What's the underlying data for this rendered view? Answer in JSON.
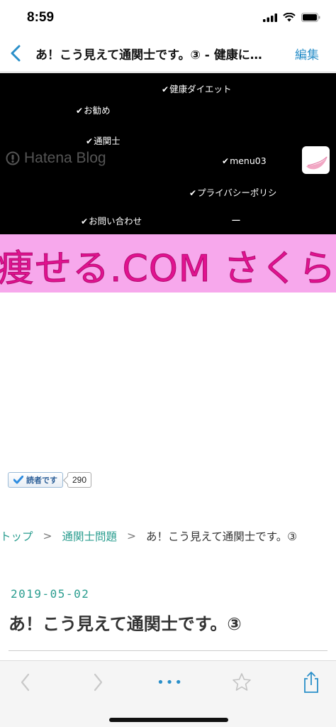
{
  "status_bar": {
    "time": "8:59"
  },
  "nav": {
    "back_icon": "chevron-left-icon",
    "title": "あ！こう見えて通関士です。③ - 健康に…",
    "edit_label": "編集"
  },
  "header": {
    "logo_text": "Hatena Blog",
    "menu": [
      {
        "label": "健康ダイエット"
      },
      {
        "label": "お勧め"
      },
      {
        "label": "通関士"
      },
      {
        "label": "menu03"
      },
      {
        "label": "プライバシーポリシ"
      },
      {
        "label": "お問い合わせ"
      }
    ],
    "dash": "ー",
    "background": "#000000"
  },
  "banner": {
    "text": "痩せる.COM さくら",
    "background": "#f7a8ec",
    "text_color": "#e1128f"
  },
  "reader": {
    "label": "読者です",
    "count": "290"
  },
  "breadcrumb": {
    "home": "トップ",
    "separator": ">",
    "category": "通関士問題",
    "current": "あ！こう見えて通関士です。③"
  },
  "article": {
    "date": "2019-05-02",
    "title": "あ！こう見えて通関士です。③"
  },
  "toolbar": {
    "back_icon": "chevron-left-icon",
    "forward_icon": "chevron-right-icon",
    "more_label": "•••",
    "bookmark_icon": "star-icon",
    "share_icon": "share-icon"
  },
  "colors": {
    "accent": "#2a8fc9",
    "link": "#2a9d8f"
  }
}
